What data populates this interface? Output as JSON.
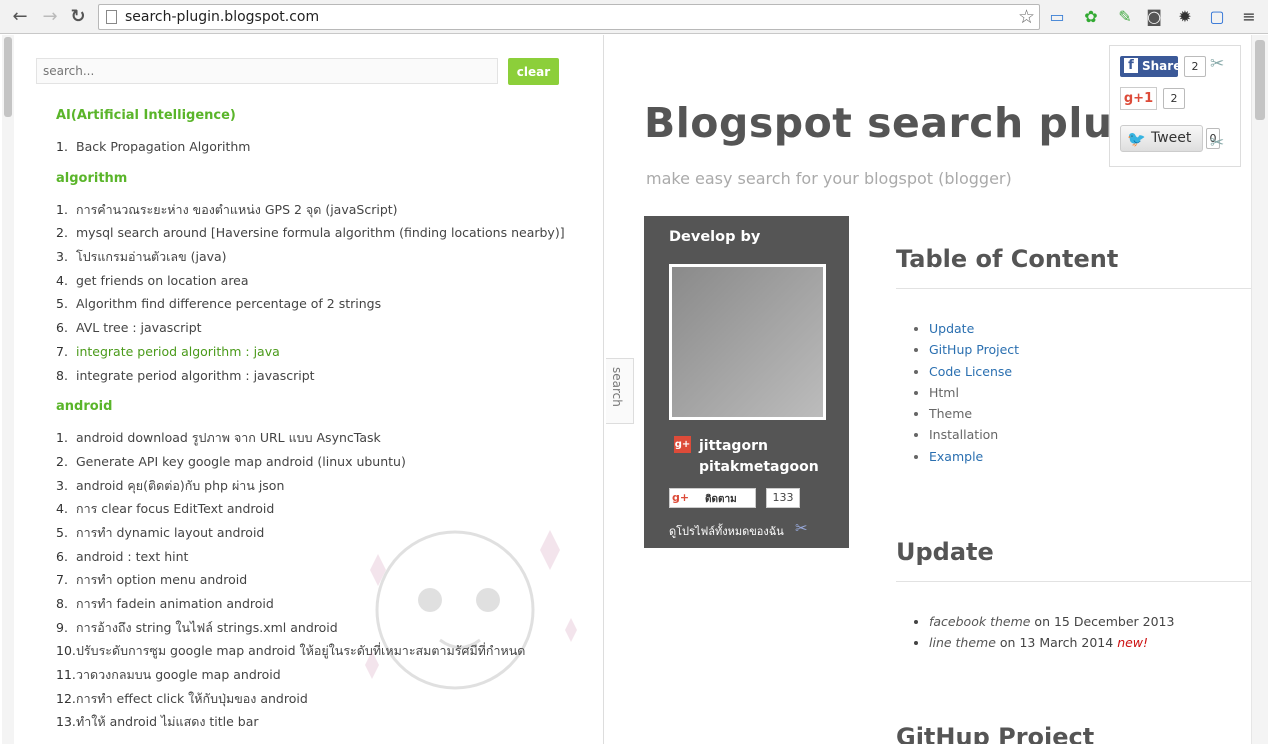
{
  "browser": {
    "url": "search-plugin.blogspot.com",
    "back_icon": "←",
    "forward_icon": "→",
    "reload_icon": "↻",
    "star_icon": "☆",
    "menu_icon": "≡"
  },
  "search": {
    "placeholder": "search...",
    "clear_label": "clear",
    "tab_label": "search"
  },
  "toc_categories": [
    {
      "name": "AI(Artificial Intelligence)",
      "items": [
        "Back Propagation Algorithm"
      ]
    },
    {
      "name": "algorithm",
      "items": [
        "การคำนวณระยะห่าง ของตำแหน่ง GPS 2 จุด (javaScript)",
        "mysql search around [Haversine formula algorithm (finding locations nearby)]",
        "โปรแกรมอ่านตัวเลข (java)",
        "get friends on location area",
        "Algorithm find difference percentage of 2 strings",
        "AVL tree : javascript",
        "integrate period algorithm : java",
        "integrate period algorithm : javascript"
      ],
      "active_index": 6
    },
    {
      "name": "android",
      "items": [
        "android download รูปภาพ จาก URL แบบ AsyncTask",
        "Generate API key google map android (linux ubuntu)",
        "android คุย(ติดต่อ)กับ php ผ่าน json",
        "การ clear focus EditText android",
        "การทำ dynamic layout android",
        "android : text hint",
        "การทำ option menu android",
        "การทำ fadein animation android",
        "การอ้างถึง string ในไฟล์ strings.xml android",
        "ปรับระดับการซูม google map android ให้อยู่ในระดับที่เหมาะสมตามรัศมีที่กำหนด",
        "วาดวงกลมบน google map android",
        "การทำ effect click ให้กับปุ่มของ android",
        "ทำให้ android ไม่แสดง title bar"
      ]
    }
  ],
  "blog": {
    "title": "Blogspot search plugin",
    "description": "make easy search for your blogspot (blogger)"
  },
  "profile": {
    "heading": "Develop by",
    "gplus_badge": "g+",
    "name": "jittagorn pitakmetagoon",
    "follow_label": "ติดตาม",
    "follow_count": "133",
    "view_all": "ดูโปรไฟล์ทั้งหมดของฉัน"
  },
  "share": {
    "fb_label": "Share",
    "fb_count": "2",
    "gplus_label": "g+1",
    "gplus_count": "2",
    "tweet_label": "Tweet",
    "tweet_count": "0"
  },
  "toc_section": {
    "heading": "Table of Content",
    "items": [
      {
        "label": "Update",
        "link": true
      },
      {
        "label": "GitHup Project",
        "link": true
      },
      {
        "label": "Code License",
        "link": true
      },
      {
        "label": "Html",
        "link": false
      },
      {
        "label": "Theme",
        "link": false
      },
      {
        "label": "Installation",
        "link": false
      },
      {
        "label": "Example",
        "link": true
      }
    ]
  },
  "update_section": {
    "heading": "Update",
    "items": [
      {
        "theme": "facebook theme",
        "rest": " on 15 December 2013",
        "badge": ""
      },
      {
        "theme": "line theme",
        "rest": " on 13 March 2014 ",
        "badge": "new!"
      }
    ]
  },
  "github_section": {
    "heading": "GitHup Project"
  },
  "colors": {
    "accent_green": "#5ab52a",
    "clear_button": "#8ccf3a",
    "link_blue": "#2a6fb0",
    "profile_bg": "#555555",
    "facebook": "#3b5998"
  }
}
